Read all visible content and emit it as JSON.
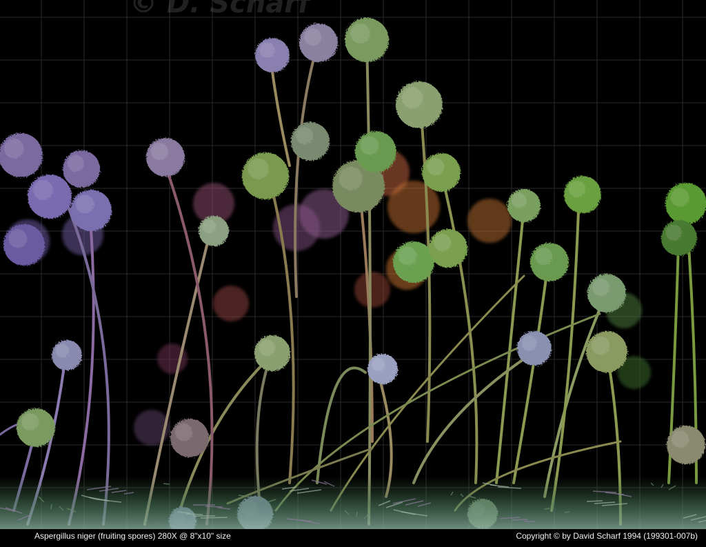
{
  "image": {
    "watermark": "© D. Scharf",
    "caption_left": "Aspergillus niger (fruiting spores)  280X @ 8\"x10\" size",
    "caption_right": "Copyright © by David Scharf 1994 (199301-007b)"
  },
  "colors": {
    "background": "#000000",
    "grid": "#2a2a2a",
    "caption_text": "#f0f0f0"
  }
}
